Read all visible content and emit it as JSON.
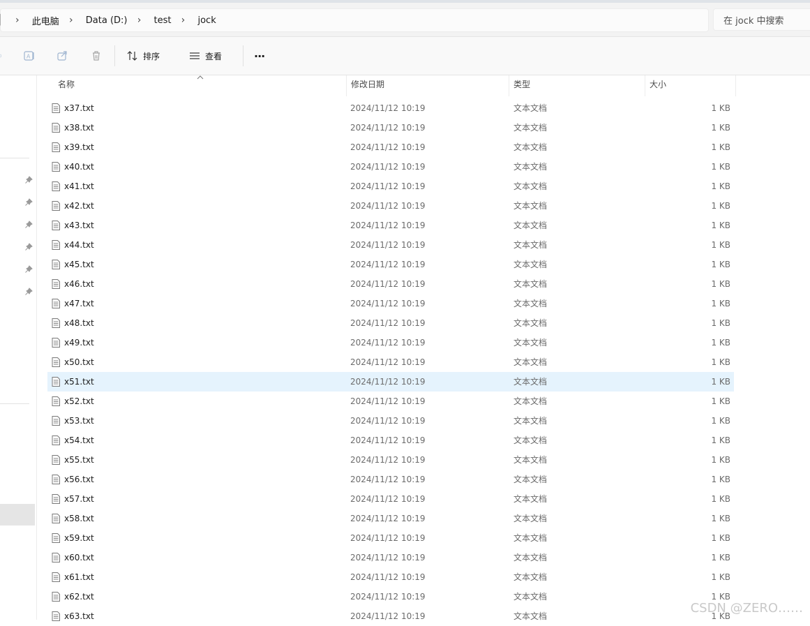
{
  "window": {
    "accent": "#0067c0",
    "selection_color": "#e5f3fd"
  },
  "address_bar": {
    "left_glyph": "▏",
    "breadcrumbs": [
      {
        "label": "此电脑"
      },
      {
        "label": "Data (D:)"
      },
      {
        "label": "test"
      },
      {
        "label": "jock"
      }
    ]
  },
  "search": {
    "placeholder": "在 jock 中搜索"
  },
  "command_bar": {
    "icons": [
      "rename-icon",
      "share-icon",
      "delete-icon"
    ],
    "sort_label": "排序",
    "view_label": "查看",
    "more_label": "···"
  },
  "columns": {
    "name": "名称",
    "modified": "修改日期",
    "type": "类型",
    "size": "大小"
  },
  "files": [
    {
      "name": "x37.txt",
      "modified": "2024/11/12 10:19",
      "type": "文本文档",
      "size": "1 KB"
    },
    {
      "name": "x38.txt",
      "modified": "2024/11/12 10:19",
      "type": "文本文档",
      "size": "1 KB"
    },
    {
      "name": "x39.txt",
      "modified": "2024/11/12 10:19",
      "type": "文本文档",
      "size": "1 KB"
    },
    {
      "name": "x40.txt",
      "modified": "2024/11/12 10:19",
      "type": "文本文档",
      "size": "1 KB"
    },
    {
      "name": "x41.txt",
      "modified": "2024/11/12 10:19",
      "type": "文本文档",
      "size": "1 KB"
    },
    {
      "name": "x42.txt",
      "modified": "2024/11/12 10:19",
      "type": "文本文档",
      "size": "1 KB"
    },
    {
      "name": "x43.txt",
      "modified": "2024/11/12 10:19",
      "type": "文本文档",
      "size": "1 KB"
    },
    {
      "name": "x44.txt",
      "modified": "2024/11/12 10:19",
      "type": "文本文档",
      "size": "1 KB"
    },
    {
      "name": "x45.txt",
      "modified": "2024/11/12 10:19",
      "type": "文本文档",
      "size": "1 KB"
    },
    {
      "name": "x46.txt",
      "modified": "2024/11/12 10:19",
      "type": "文本文档",
      "size": "1 KB"
    },
    {
      "name": "x47.txt",
      "modified": "2024/11/12 10:19",
      "type": "文本文档",
      "size": "1 KB"
    },
    {
      "name": "x48.txt",
      "modified": "2024/11/12 10:19",
      "type": "文本文档",
      "size": "1 KB"
    },
    {
      "name": "x49.txt",
      "modified": "2024/11/12 10:19",
      "type": "文本文档",
      "size": "1 KB"
    },
    {
      "name": "x50.txt",
      "modified": "2024/11/12 10:19",
      "type": "文本文档",
      "size": "1 KB"
    },
    {
      "name": "x51.txt",
      "modified": "2024/11/12 10:19",
      "type": "文本文档",
      "size": "1 KB",
      "selected": true
    },
    {
      "name": "x52.txt",
      "modified": "2024/11/12 10:19",
      "type": "文本文档",
      "size": "1 KB"
    },
    {
      "name": "x53.txt",
      "modified": "2024/11/12 10:19",
      "type": "文本文档",
      "size": "1 KB"
    },
    {
      "name": "x54.txt",
      "modified": "2024/11/12 10:19",
      "type": "文本文档",
      "size": "1 KB"
    },
    {
      "name": "x55.txt",
      "modified": "2024/11/12 10:19",
      "type": "文本文档",
      "size": "1 KB"
    },
    {
      "name": "x56.txt",
      "modified": "2024/11/12 10:19",
      "type": "文本文档",
      "size": "1 KB"
    },
    {
      "name": "x57.txt",
      "modified": "2024/11/12 10:19",
      "type": "文本文档",
      "size": "1 KB"
    },
    {
      "name": "x58.txt",
      "modified": "2024/11/12 10:19",
      "type": "文本文档",
      "size": "1 KB"
    },
    {
      "name": "x59.txt",
      "modified": "2024/11/12 10:19",
      "type": "文本文档",
      "size": "1 KB"
    },
    {
      "name": "x60.txt",
      "modified": "2024/11/12 10:19",
      "type": "文本文档",
      "size": "1 KB"
    },
    {
      "name": "x61.txt",
      "modified": "2024/11/12 10:19",
      "type": "文本文档",
      "size": "1 KB"
    },
    {
      "name": "x62.txt",
      "modified": "2024/11/12 10:19",
      "type": "文本文档",
      "size": "1 KB"
    },
    {
      "name": "x63.txt",
      "modified": "2024/11/12 10:19",
      "type": "文本文档",
      "size": "1 KB"
    }
  ],
  "watermark": "CSDN @ZERO……"
}
